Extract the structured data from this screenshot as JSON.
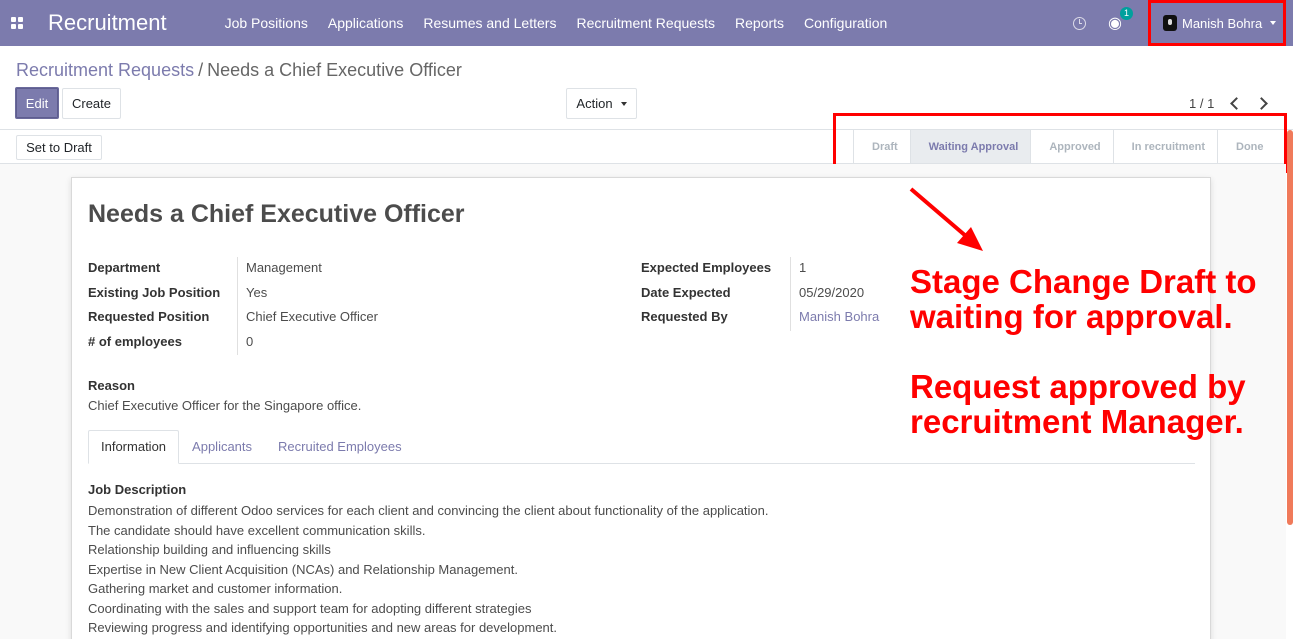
{
  "nav": {
    "brand": "Recruitment",
    "menu": [
      "Job Positions",
      "Applications",
      "Resumes and Letters",
      "Recruitment Requests",
      "Reports",
      "Configuration"
    ],
    "chat_badge": "1",
    "user": "Manish Bohra"
  },
  "control": {
    "breadcrumb_parent": "Recruitment Requests",
    "breadcrumb_sep": "/",
    "breadcrumb_current": "Needs a Chief Executive Officer",
    "edit_label": "Edit",
    "create_label": "Create",
    "action_label": "Action",
    "pager": "1 / 1"
  },
  "statusbar": {
    "set_to_draft_label": "Set to Draft",
    "stages": [
      "Draft",
      "Waiting Approval",
      "Approved",
      "In recruitment",
      "Done"
    ],
    "current_stage": "Waiting Approval"
  },
  "form": {
    "title": "Needs a Chief Executive Officer",
    "left_fields": [
      {
        "label": "Department",
        "value": "Management"
      },
      {
        "label": "Existing Job Position",
        "value": "Yes"
      },
      {
        "label": "Requested Position",
        "value": "Chief Executive Officer"
      },
      {
        "label": "# of employees",
        "value": "0"
      }
    ],
    "right_fields": [
      {
        "label": "Expected Employees",
        "value": "1"
      },
      {
        "label": "Date Expected",
        "value": "05/29/2020"
      },
      {
        "label": "Requested By",
        "value": "Manish Bohra"
      }
    ],
    "reason_label": "Reason",
    "reason_text": "Chief Executive Officer for the Singapore office.",
    "tabs": [
      "Information",
      "Applicants",
      "Recruited Employees"
    ],
    "job_description_label": "Job Description",
    "job_description": [
      "Demonstration of different Odoo services for each client and convincing the client about functionality of the application.",
      "The candidate should have excellent communication skills.",
      "Relationship building and influencing skills",
      "Expertise in New Client Acquisition (NCAs) and Relationship Management.",
      "Gathering market and customer information.",
      "Coordinating with the sales and support team for adopting different strategies",
      "Reviewing progress and identifying opportunities and new areas for development."
    ]
  },
  "annotation": {
    "line1": "Stage Change Draft to",
    "line2": "waiting for approval.",
    "line3": "Request approved by",
    "line4": "recruitment Manager."
  },
  "colors": {
    "brand": "#7c7bad",
    "annotation": "#ff0000",
    "chat_badge": "#00a09d"
  }
}
